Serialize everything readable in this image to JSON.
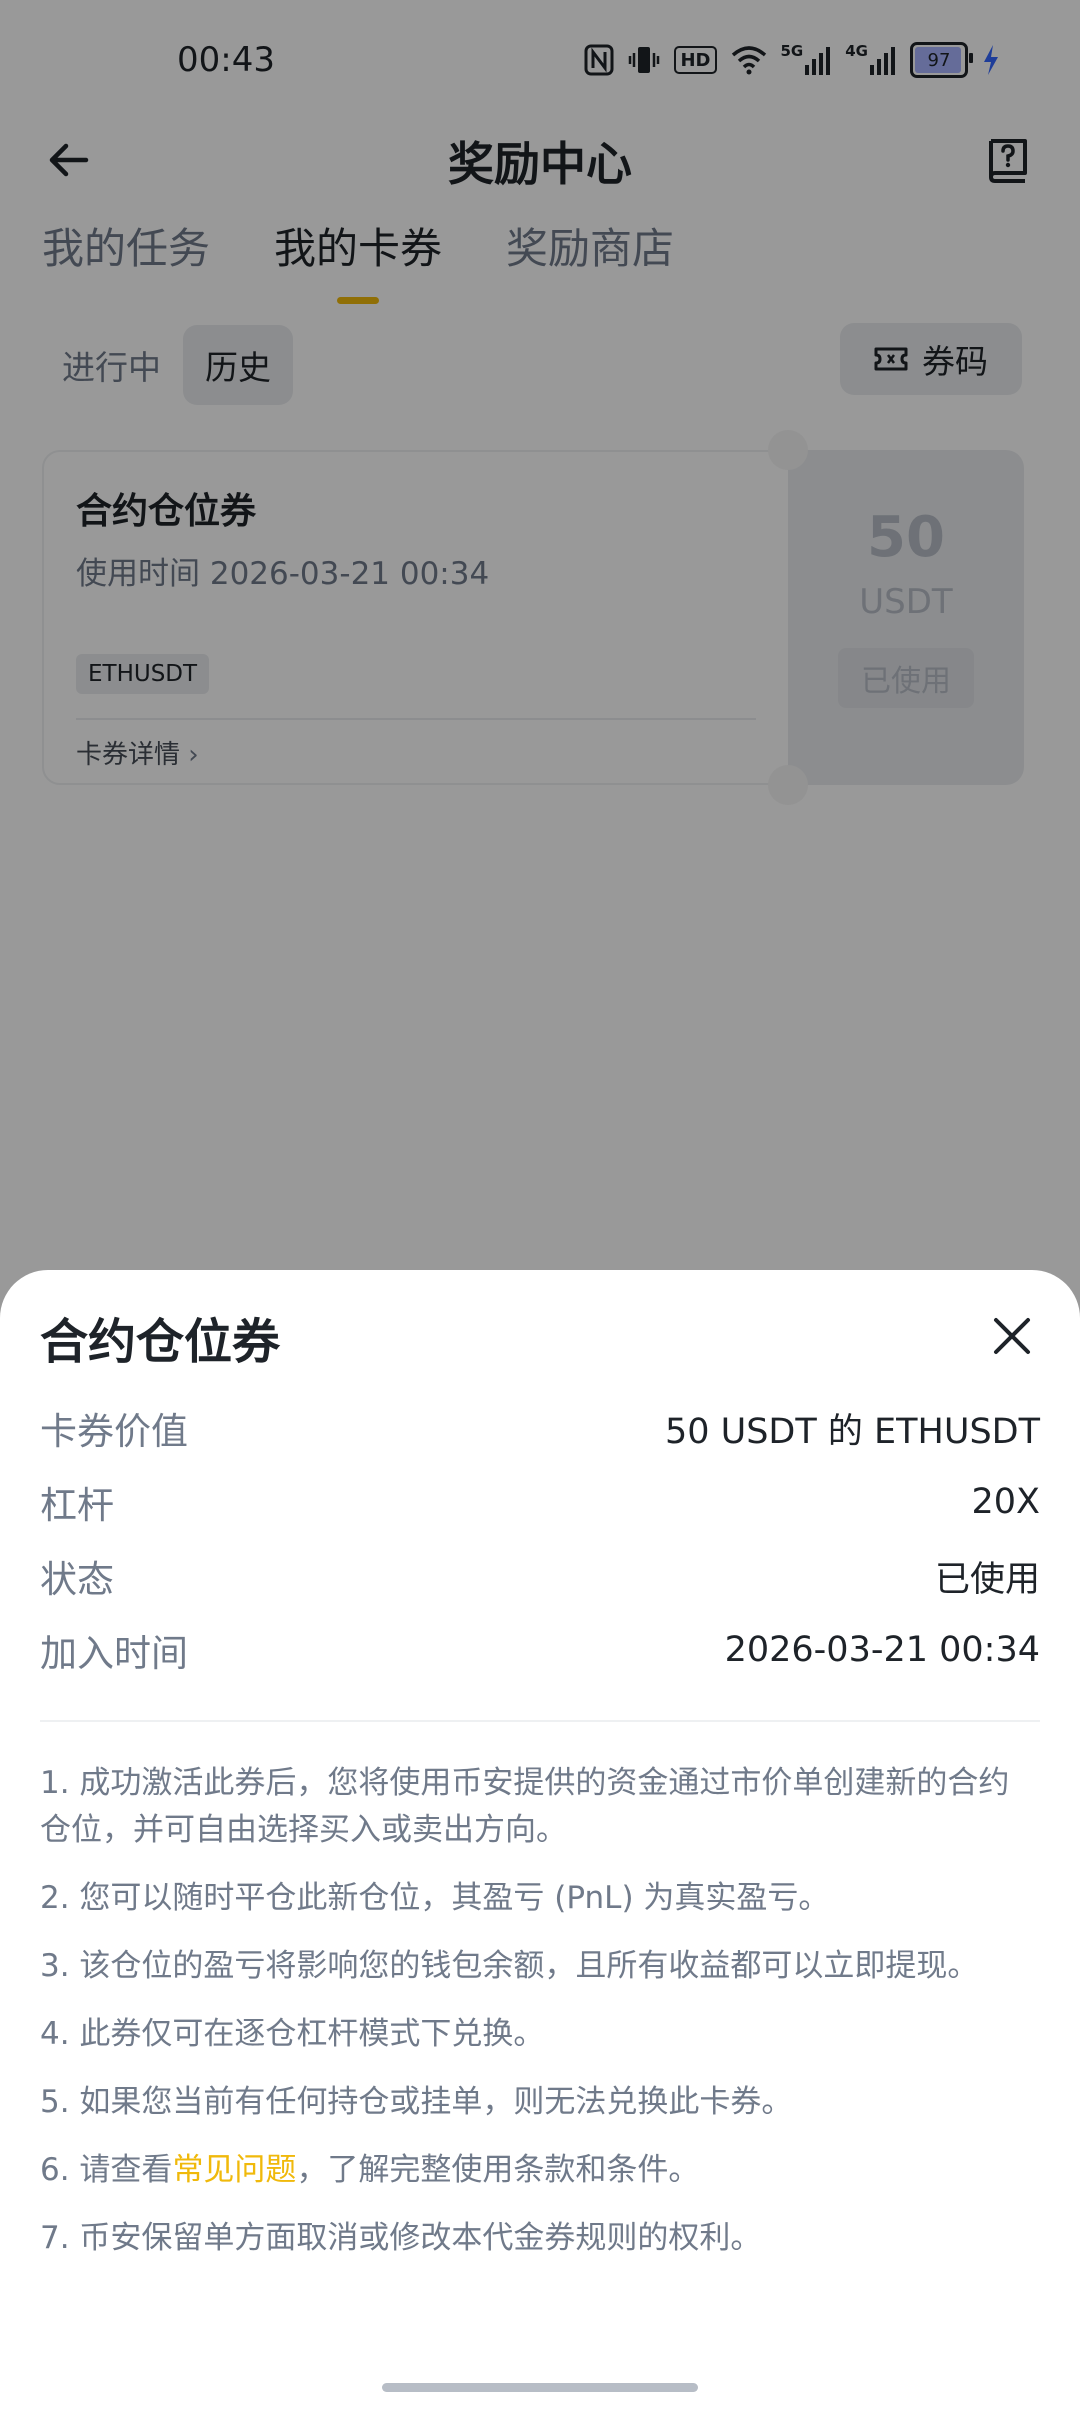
{
  "status_bar": {
    "time": "00:43",
    "icons": [
      "nfc-icon",
      "vibrate-icon",
      "hd-icon",
      "wifi-icon",
      "signal-5g-icon",
      "signal-4g-icon"
    ],
    "hd_label": "HD",
    "sig5g_label": "5G",
    "sig4g_label": "4G",
    "battery": "97"
  },
  "header": {
    "title": "奖励中心",
    "back_icon": "arrow-left-icon",
    "help_icon": "help-book-icon"
  },
  "tabs": [
    {
      "label": "我的任务",
      "active": false
    },
    {
      "label": "我的卡券",
      "active": true
    },
    {
      "label": "奖励商店",
      "active": false
    }
  ],
  "filters": {
    "in_progress": "进行中",
    "history": "历史",
    "code_button": "券码",
    "code_icon": "ticket-icon"
  },
  "coupon": {
    "name": "合约仓位券",
    "time": "使用时间 2026-03-21 00:34",
    "tag": "ETHUSDT",
    "detail_link": "卡券详情",
    "value": "50",
    "unit": "USDT",
    "status": "已使用"
  },
  "sheet": {
    "title": "合约仓位券",
    "close_icon": "close-icon",
    "rows": [
      {
        "key": "卡券价值",
        "value": "50 USDT 的 ETHUSDT"
      },
      {
        "key": "杠杆",
        "value": "20X"
      },
      {
        "key": "状态",
        "value": "已使用"
      },
      {
        "key": "加入时间",
        "value": "2026-03-21 00:34"
      }
    ],
    "terms": [
      "1. 成功激活此券后，您将使用币安提供的资金通过市价单创建新的合约仓位，并可自由选择买入或卖出方向。",
      "2. 您可以随时平仓此新仓位，其盈亏 (PnL) 为真实盈亏。",
      "3. 该仓位的盈亏将影响您的钱包余额，且所有收益都可以立即提现。",
      "4. 此券仅可在逐仓杠杆模式下兑换。",
      "5. 如果您当前有任何持仓或挂单，则无法兑换此卡券。"
    ],
    "term6_prefix": "6. 请查看",
    "term6_link": "常见问题",
    "term6_suffix": "，了解完整使用条款和条件。",
    "term7": "7. 币安保留单方面取消或修改本代金券规则的权利。"
  },
  "colors": {
    "accent": "#f0b90b",
    "overlay": "rgba(0,0,0,0.40)"
  }
}
